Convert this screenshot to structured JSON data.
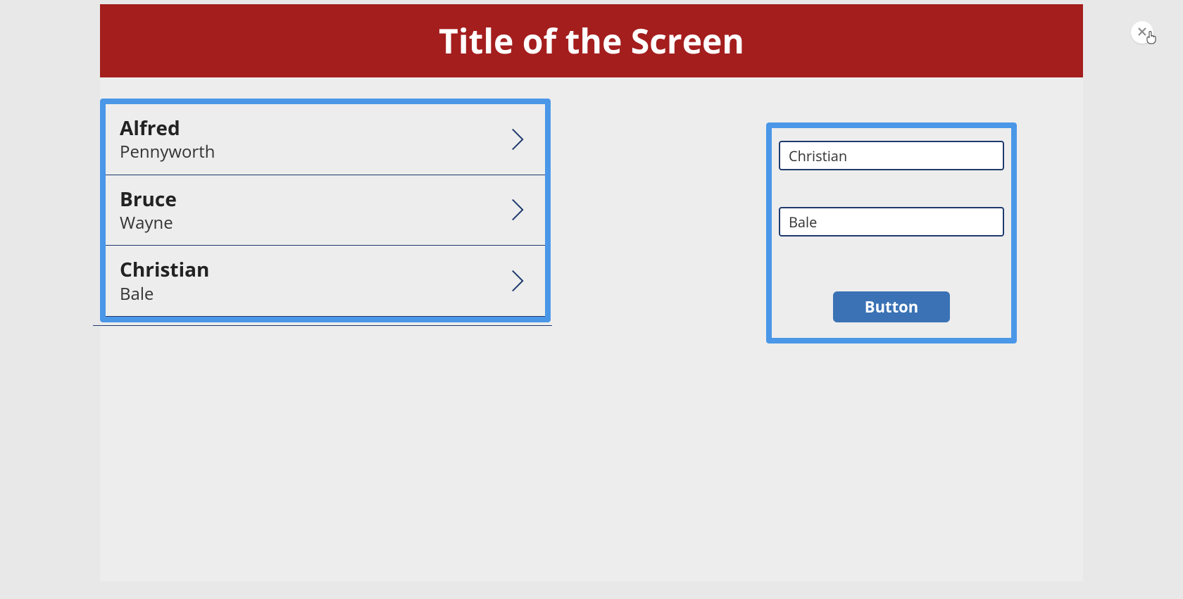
{
  "header": {
    "title": "Title of the Screen"
  },
  "list": {
    "items": [
      {
        "title": "Alfred",
        "subtitle": "Pennyworth"
      },
      {
        "title": "Bruce",
        "subtitle": "Wayne"
      },
      {
        "title": "Christian",
        "subtitle": "Bale"
      }
    ]
  },
  "form": {
    "input1_value": "Christian",
    "input2_value": "Bale",
    "button_label": "Button"
  },
  "colors": {
    "accent": "#4a97e8",
    "header_bg": "#a41e1e",
    "button_bg": "#3a72b5",
    "border_dark": "#1f3a6e"
  }
}
